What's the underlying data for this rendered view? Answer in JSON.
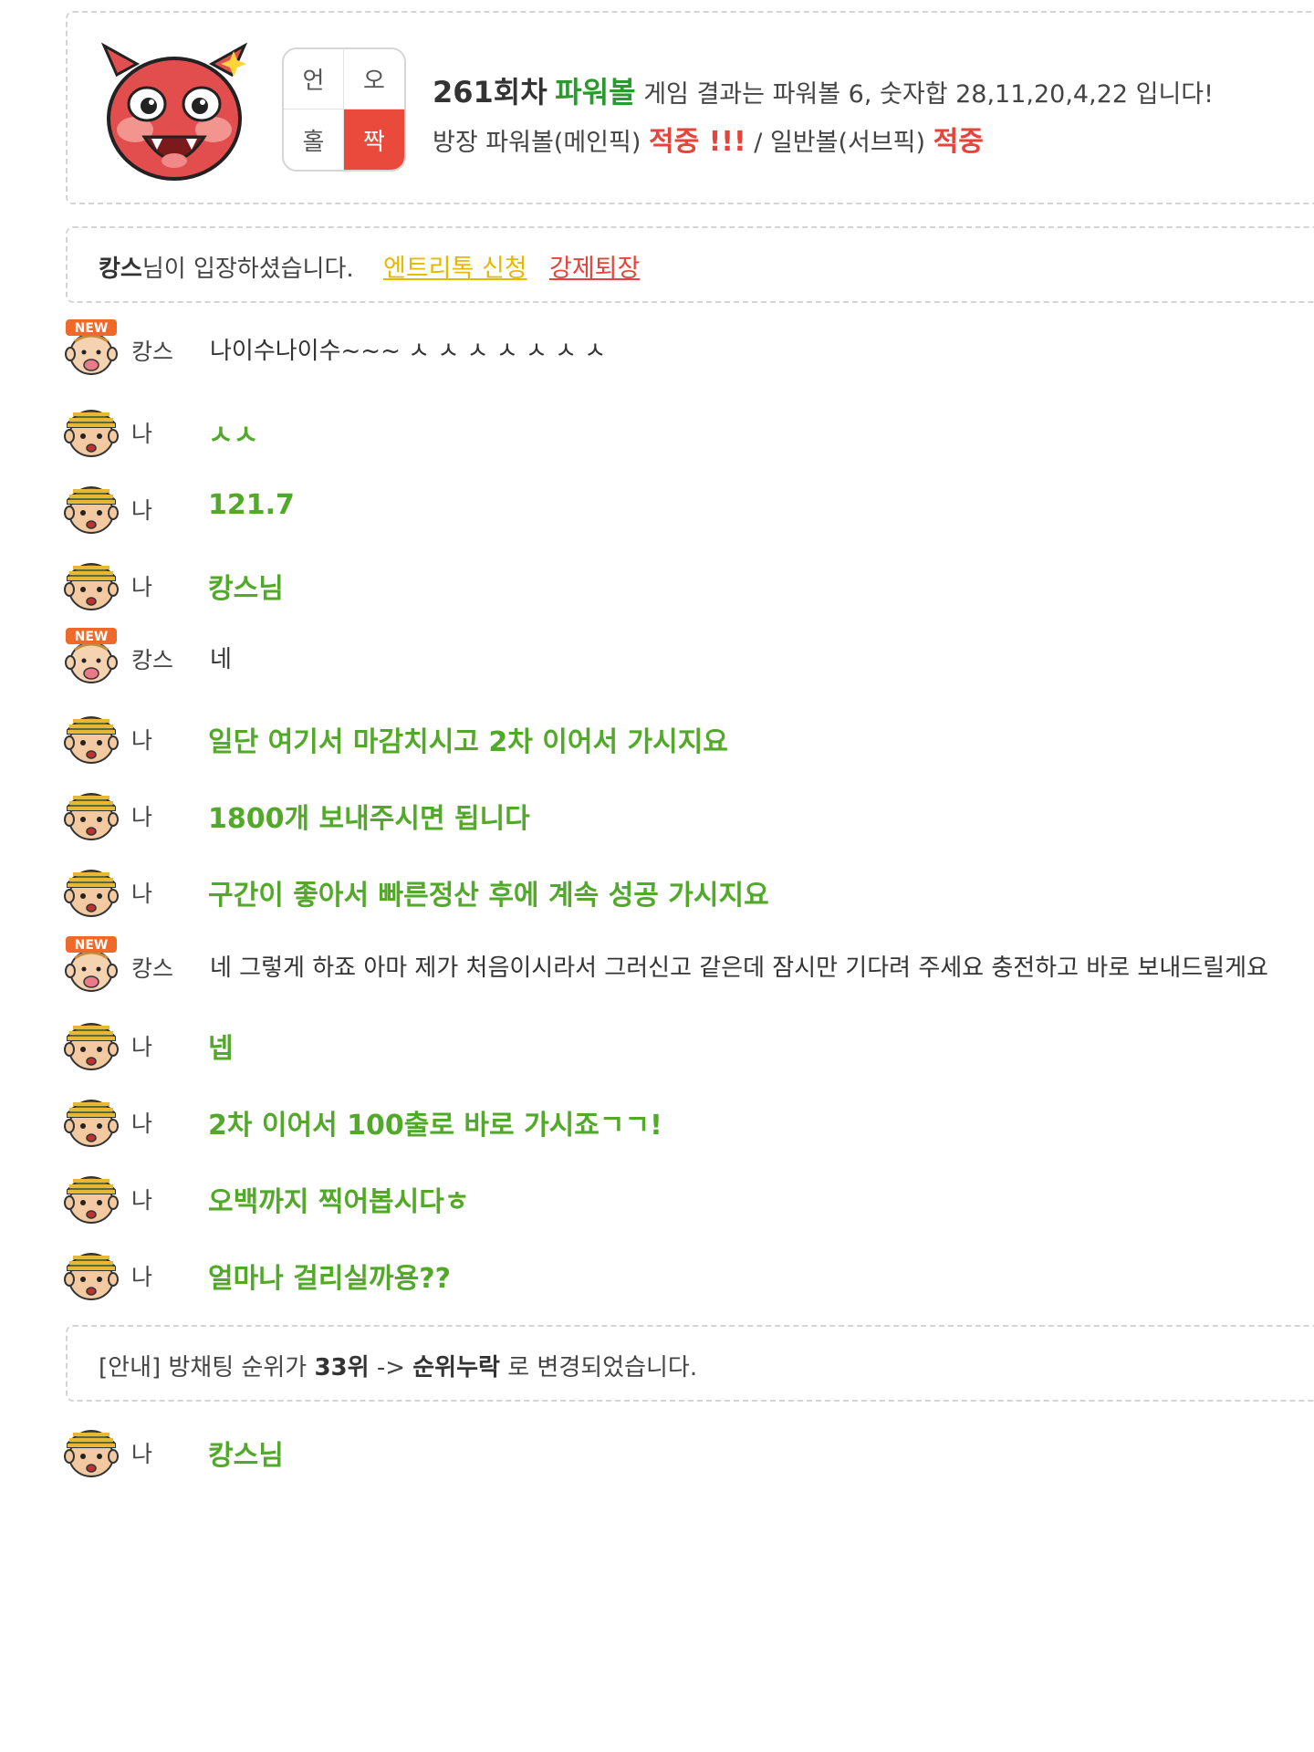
{
  "result": {
    "round": "261회차",
    "game": "파워볼",
    "text": "게임 결과는 파워볼 6, 숫자합 28,11,20,4,22 입니다!",
    "grid": [
      "언",
      "오",
      "홀",
      "짝"
    ],
    "host_label": "방장 파워볼(메인픽)",
    "host_result": "적중 !!!",
    "separator": " / ",
    "sub_label": "일반볼(서브픽)",
    "sub_result": "적중"
  },
  "join": {
    "user": "캉스",
    "text": "님이 입장하셨습니다.",
    "link_entry": "엔트리톡 신청",
    "link_kick": "강제퇴장"
  },
  "messages": [
    {
      "nick": "캉스",
      "text": "나이수나이수~~~ ㅅ ㅅ ㅅ ㅅ ㅅ ㅅ ㅅ"
    },
    {
      "nick": "나",
      "text": "ㅅㅅ"
    },
    {
      "nick": "나",
      "text": "121.7"
    },
    {
      "nick": "나",
      "text": "캉스님"
    },
    {
      "nick": "캉스",
      "text": "네"
    },
    {
      "nick": "나",
      "text": "일단 여기서 마감치시고 2차 이어서 가시지요"
    },
    {
      "nick": "나",
      "text": "1800개 보내주시면 됩니다"
    },
    {
      "nick": "나",
      "text": "구간이 좋아서 빠른정산 후에 계속 성공 가시지요"
    },
    {
      "nick": "캉스",
      "text": "네 그렇게 하죠 아마 제가 처음이시라서 그러신고 같은데 잠시만 기다려 주세요 충전하고 바로 보내드릴게요"
    },
    {
      "nick": "나",
      "text": "넵"
    },
    {
      "nick": "나",
      "text": "2차 이어서 100출로 바로 가시죠ㄱㄱ!"
    },
    {
      "nick": "나",
      "text": "오백까지 찍어봅시다ㅎ"
    },
    {
      "nick": "나",
      "text": "얼마나 걸리실까용??"
    },
    {
      "nick": "나",
      "text": "캉스님"
    }
  ],
  "notice": {
    "prefix": "[안내] 방채팅 순위가 ",
    "from": "33위",
    "arrow": " -> ",
    "to": "순위누락",
    "suffix": " 로 변경되었습니다."
  },
  "colors": {
    "my_message": "#52a829",
    "hit_red": "#e4443a",
    "grid_hit": "#ea4a3b",
    "entry_link": "#e6b800"
  }
}
